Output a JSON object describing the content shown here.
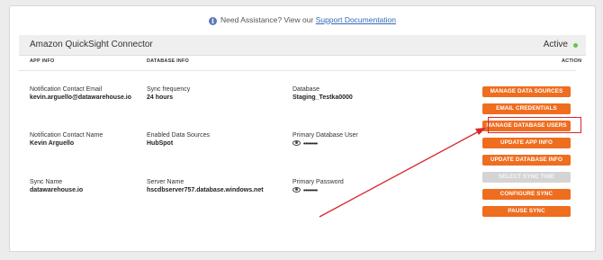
{
  "assistance": {
    "prefix": "Need Assistance? View our ",
    "link": "Support Documentation",
    "icon": "info-icon"
  },
  "connector": {
    "title": "Amazon QuickSight Connector",
    "status": "Active",
    "status_color": "#6cc24a"
  },
  "columns": {
    "app_info": "APP INFO",
    "database_info": "DATABASE INFO",
    "action": "ACTION"
  },
  "app_info": {
    "contact_email_label": "Notification Contact Email",
    "contact_email": "kevin.arguello@datawarehouse.io",
    "contact_name_label": "Notification Contact Name",
    "contact_name": "Kevin Arguello",
    "sync_name_label": "Sync Name",
    "sync_name": "datawarehouse.io"
  },
  "database_info": {
    "sync_frequency_label": "Sync frequency",
    "sync_frequency": "24 hours",
    "enabled_sources_label": "Enabled Data Sources",
    "enabled_sources": "HubSpot",
    "server_name_label": "Server Name",
    "server_name": "hscdbserver757.database.windows.net",
    "database_label": "Database",
    "database": "Staging_Testka0000",
    "primary_user_label": "Primary Database User",
    "primary_user_mask": "••••••••",
    "primary_password_label": "Primary Password",
    "primary_password_mask": "••••••••"
  },
  "actions": {
    "manage_data_sources": "MANAGE DATA SOURCES",
    "email_credentials": "EMAIL CREDENTIALS",
    "manage_database_users": "MANAGE DATABASE USERS",
    "update_app_info": "UPDATE APP INFO",
    "update_database_info": "UPDATE DATABASE INFO",
    "select_sync_time": "SELECT SYNC TIME",
    "configure_sync": "CONFIGURE SYNC",
    "pause_sync": "PAUSE SYNC"
  },
  "colors": {
    "accent": "#ee6d1f",
    "disabled": "#d4d4d4",
    "annotation": "#d9262b"
  }
}
